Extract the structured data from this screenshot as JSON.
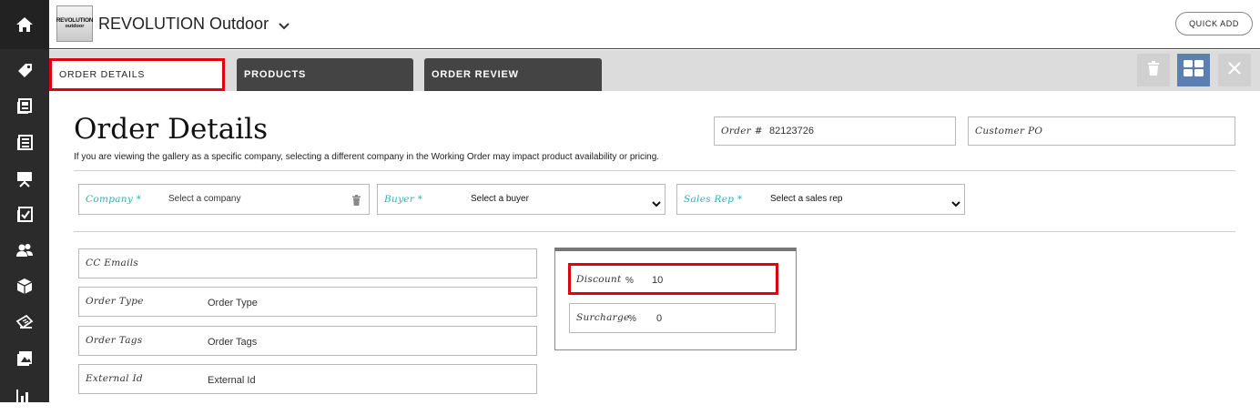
{
  "header": {
    "logo_line1": "REVOLUTION",
    "logo_line2": "outdoor",
    "company_name": "REVOLUTION Outdoor",
    "quick_add_label": "QUICK ADD"
  },
  "sidebar": {
    "icons": [
      "home-icon",
      "tag-icon",
      "catalog-icon",
      "list-icon",
      "presentation-icon",
      "checklist-icon",
      "users-icon",
      "box-icon",
      "tickets-icon",
      "image-icon",
      "chart-icon"
    ]
  },
  "tabs": [
    {
      "label": "ORDER DETAILS",
      "active": true
    },
    {
      "label": "PRODUCTS",
      "active": false
    },
    {
      "label": "ORDER REVIEW",
      "active": false
    }
  ],
  "toolbar": {
    "buttons": [
      "trash-icon",
      "grid-icon",
      "close-icon"
    ]
  },
  "page": {
    "title": "Order Details",
    "subtitle": "If you are viewing the gallery as a specific company, selecting a different company in the Working Order may impact product availability or pricing."
  },
  "order_number": {
    "label": "Order #",
    "value": "82123726"
  },
  "customer_po": {
    "label": "Customer PO",
    "value": ""
  },
  "selects": {
    "company": {
      "label": "Company *",
      "value": "Select a company"
    },
    "buyer": {
      "label": "Buyer *",
      "value": "Select a buyer"
    },
    "sales_rep": {
      "label": "Sales Rep *",
      "value": "Select a sales rep"
    }
  },
  "fields": {
    "cc_emails": {
      "label": "CC Emails",
      "value": ""
    },
    "order_type": {
      "label": "Order Type",
      "value": "Order Type"
    },
    "order_tags": {
      "label": "Order Tags",
      "value": "Order Tags"
    },
    "external_id": {
      "label": "External Id",
      "value": "External Id"
    }
  },
  "adjustments": {
    "discount": {
      "label": "Discount",
      "unit": "%",
      "value": "10"
    },
    "surcharge": {
      "label": "Surcharge",
      "unit": "%",
      "value": "0"
    }
  },
  "colors": {
    "rail": "#2b2b2b",
    "highlight": "#e0000e",
    "teal_label": "#2bb4b4",
    "grid_button": "#5a7fb0",
    "tab_dark": "#444444"
  }
}
